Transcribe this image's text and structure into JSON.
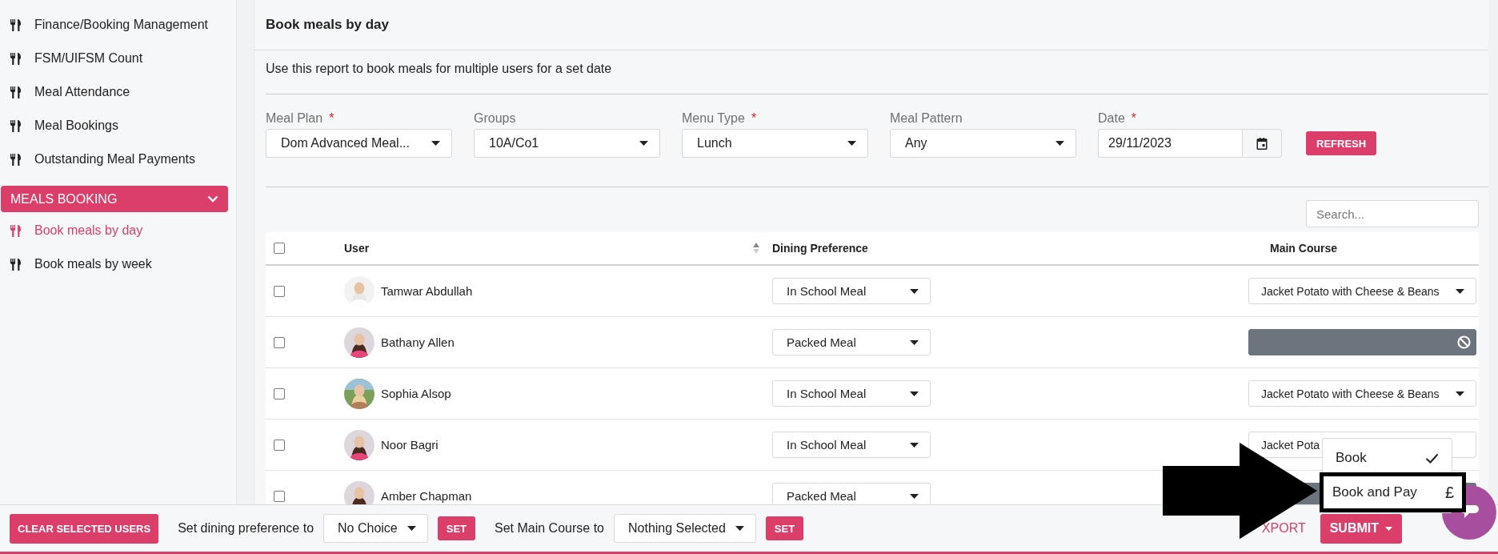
{
  "sidebar": {
    "items": [
      {
        "label": "Finance/Booking Management",
        "selected": false
      },
      {
        "label": "FSM/UIFSM Count",
        "selected": false
      },
      {
        "label": "Meal Attendance",
        "selected": false
      },
      {
        "label": "Meal Bookings",
        "selected": false
      },
      {
        "label": "Outstanding Meal Payments",
        "selected": false
      }
    ],
    "section": {
      "label": "MEALS BOOKING",
      "expanded": true,
      "items": [
        {
          "label": "Book meals by day",
          "selected": true
        },
        {
          "label": "Book meals by week",
          "selected": false
        }
      ]
    }
  },
  "page": {
    "title": "Book meals by day",
    "description": "Use this report to book meals for multiple users for a set date"
  },
  "filters": [
    {
      "kind": "select",
      "label": "Meal Plan",
      "required_mark": "*",
      "value": "Dom Advanced Meal..."
    },
    {
      "kind": "select",
      "label": "Groups",
      "value": "10A/Co1"
    },
    {
      "kind": "select",
      "label": "Menu Type",
      "required_mark": "*",
      "value": "Lunch"
    },
    {
      "kind": "select",
      "label": "Meal Pattern",
      "value": "Any"
    },
    {
      "kind": "date",
      "label": "Date",
      "required_mark": "*",
      "value": "29/11/2023"
    }
  ],
  "refresh_button": "REFRESH",
  "search": {
    "placeholder": "Search..."
  },
  "table": {
    "all_checked": false,
    "columns": [
      {
        "label": "User",
        "sortable": true
      },
      {
        "label": "Dining Preference",
        "sortable": false
      },
      {
        "label": "Main Course",
        "sortable": false
      }
    ],
    "rows": [
      {
        "checked": false,
        "user": "Tamwar Abdullah",
        "dining": "In School Meal",
        "main_course": {
          "value": "Jacket Potato with Cheese & Beans",
          "disabled": false,
          "covered": false
        }
      },
      {
        "checked": false,
        "user": "Bathany Allen",
        "dining": "Packed Meal",
        "main_course": {
          "disabled": true,
          "covered": false
        }
      },
      {
        "checked": false,
        "user": "Sophia Alsop",
        "dining": "In School Meal",
        "main_course": {
          "value": "Jacket Potato with Cheese & Beans",
          "disabled": false,
          "covered": false
        }
      },
      {
        "checked": false,
        "user": "Noor Bagri",
        "dining": "In School Meal",
        "main_course": {
          "value": "Jacket Pota",
          "disabled": false,
          "covered": true
        }
      },
      {
        "checked": false,
        "user": "Amber Chapman",
        "dining": "Packed Meal",
        "main_course": {
          "disabled": true,
          "covered": true
        }
      }
    ]
  },
  "footer": {
    "clear_button": "CLEAR SELECTED USERS",
    "dining_label": "Set dining preference to",
    "dining_value": "No Choice",
    "dining_set": "SET",
    "main_label": "Set Main Course to",
    "main_value": "Nothing Selected",
    "main_set": "SET",
    "export": "XPORT",
    "submit": "SUBMIT"
  },
  "submit_menu": {
    "items": [
      {
        "label": "Book",
        "selected": true,
        "highlighted": false
      },
      {
        "label": "Book and Pay",
        "symbol": "£",
        "selected": false,
        "highlighted": true
      }
    ]
  }
}
